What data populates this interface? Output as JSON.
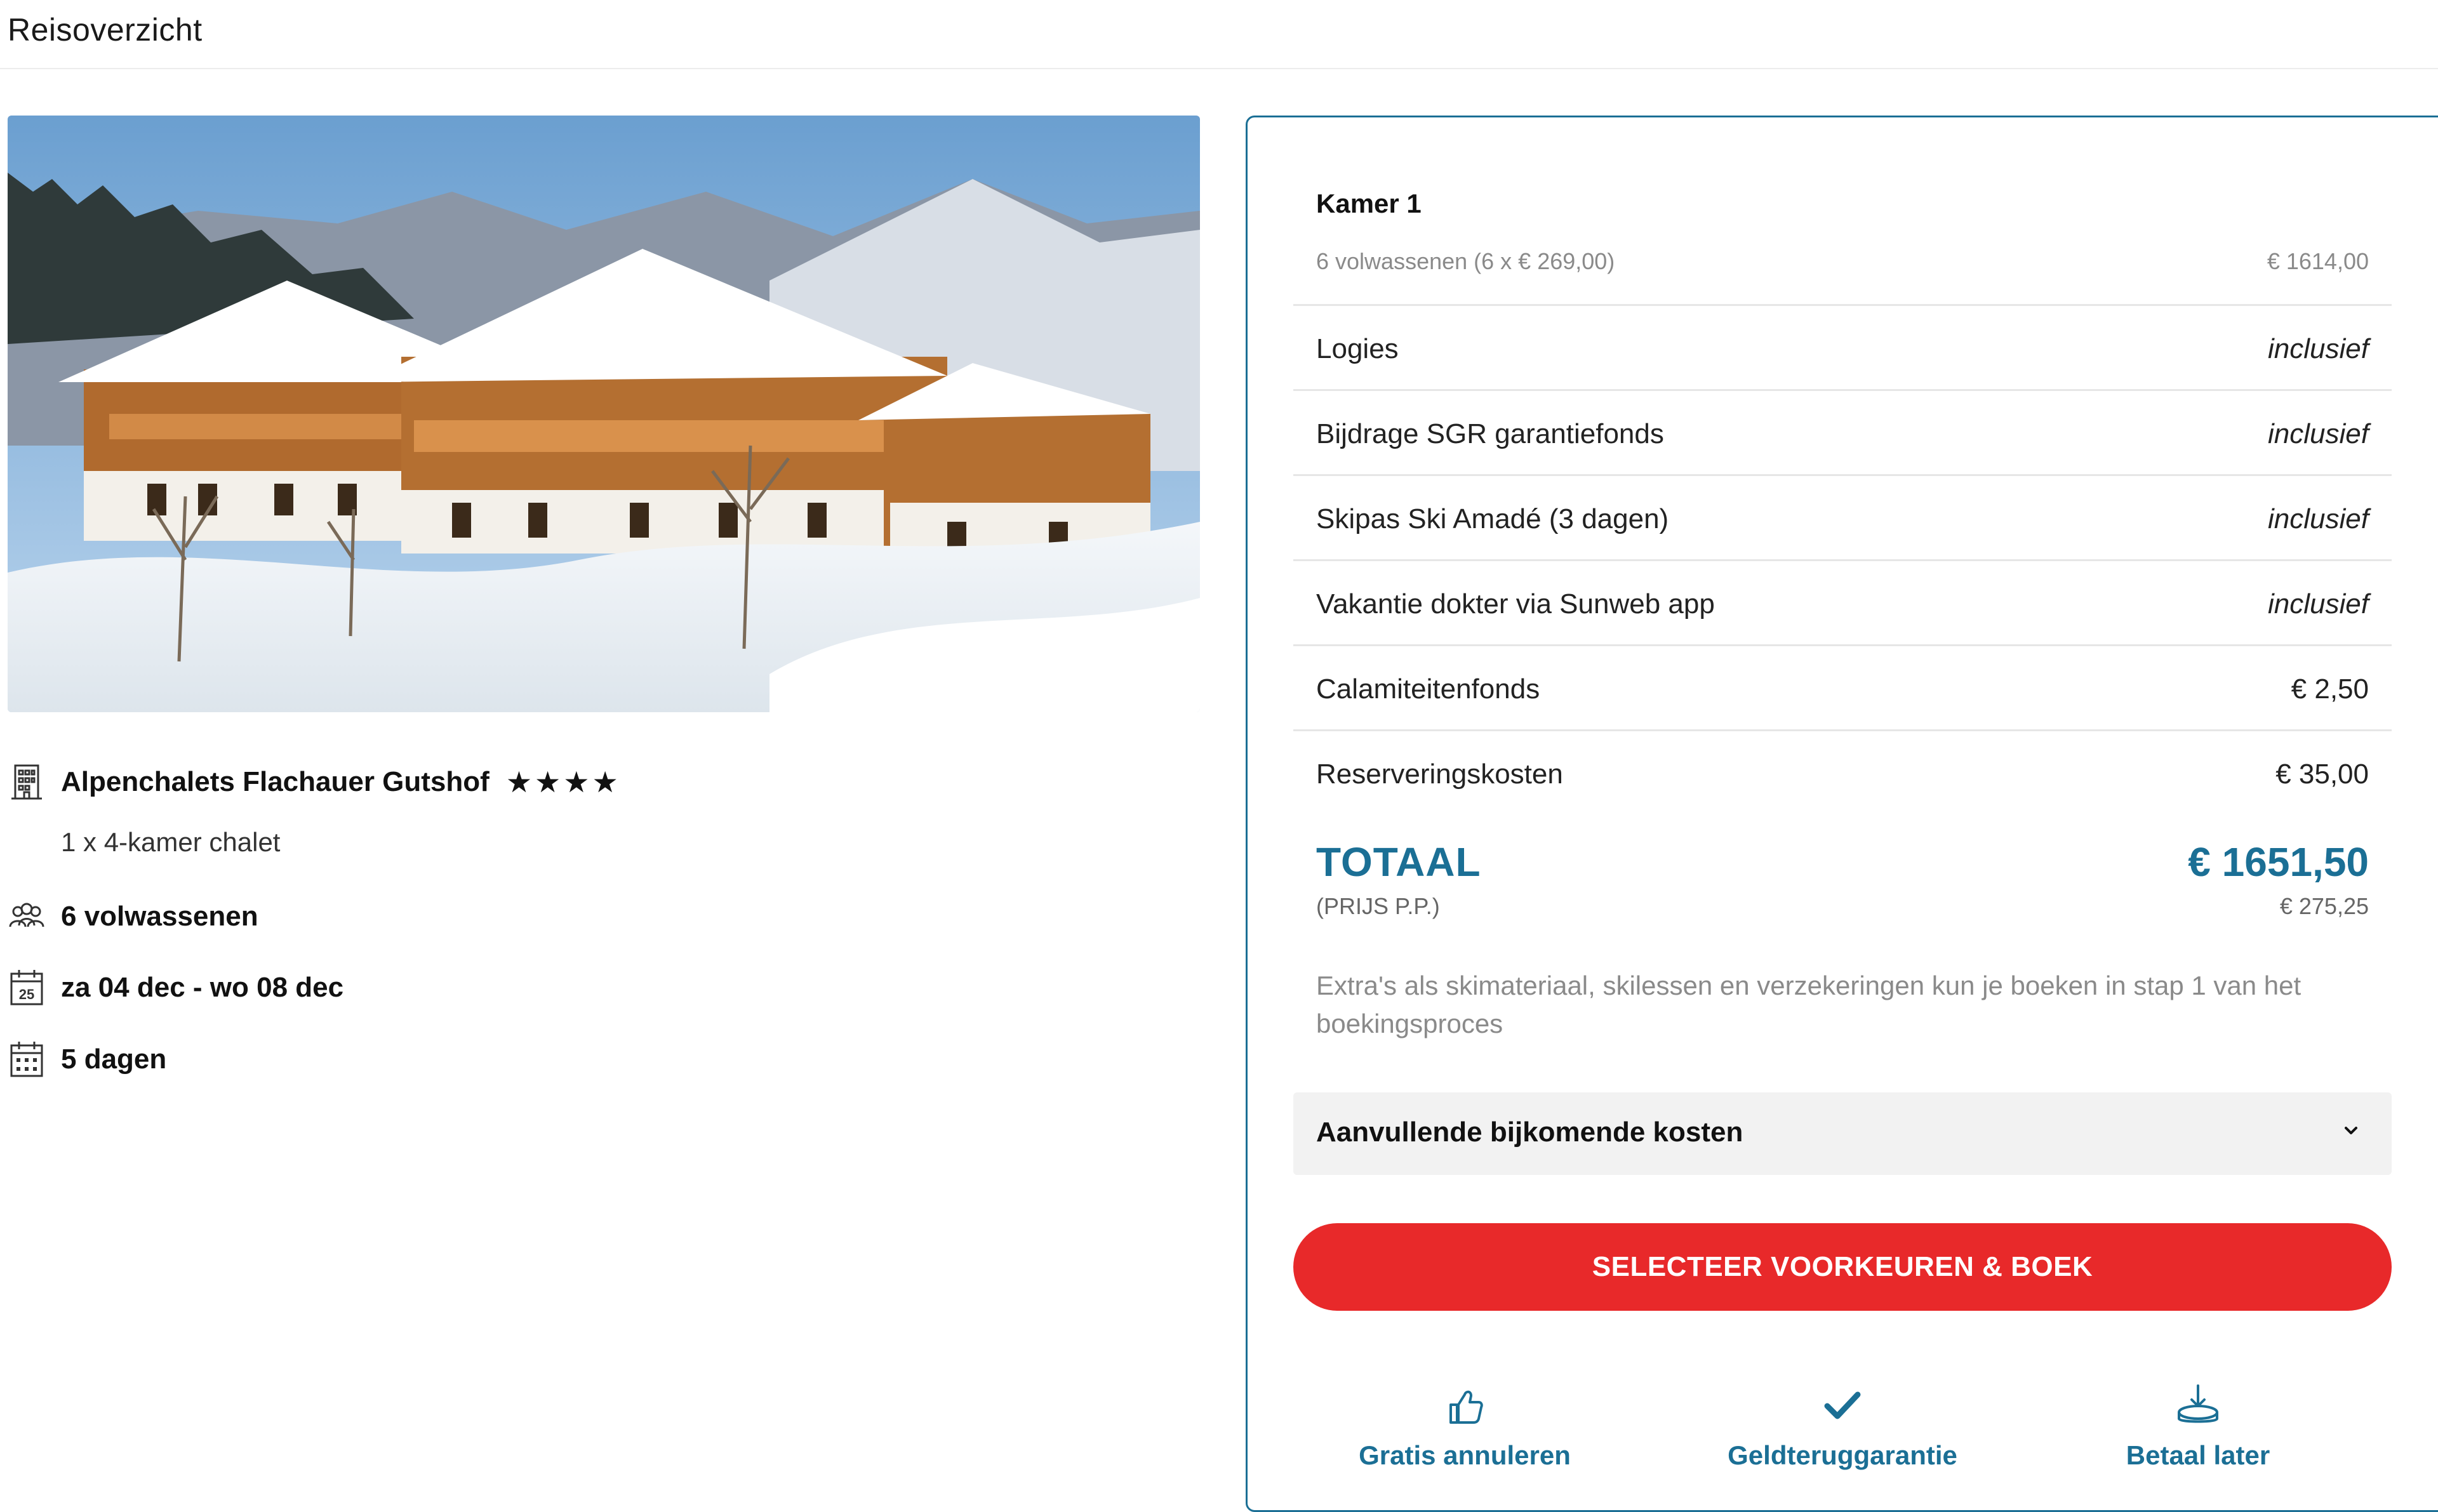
{
  "header": {
    "title": "Reisoverzicht"
  },
  "hotel": {
    "name": "Alpenchalets Flachauer Gutshof",
    "stars": "★★★★",
    "room_type": "1 x 4-kamer chalet",
    "image_alt": "Chalets in de sneeuw"
  },
  "trip": {
    "guests": "6 volwassenen",
    "dates": "za 04 dec - wo 08 dec",
    "calendar_day": "25",
    "duration": "5 dagen"
  },
  "summary": {
    "room_title": "Kamer 1",
    "room_detail": "6 volwassenen (6 x € 269,00)",
    "room_price": "€ 1614,00",
    "lines": [
      {
        "label": "Logies",
        "value": "inclusief"
      },
      {
        "label": "Bijdrage SGR garantiefonds",
        "value": "inclusief"
      },
      {
        "label": "Skipas Ski Amadé (3 dagen)",
        "value": "inclusief"
      },
      {
        "label": "Vakantie dokter via Sunweb app",
        "value": "inclusief"
      },
      {
        "label": "Calamiteitenfonds",
        "value": "€ 2,50"
      },
      {
        "label": "Reserveringskosten",
        "value": "€ 35,00"
      }
    ],
    "total_label": "TOTAAL",
    "total_value": "€ 1651,50",
    "pp_label": "(PRIJS P.P.)",
    "pp_value": "€ 275,25",
    "extras_note": "Extra's als skimateriaal, skilessen en verzekeringen kun je boeken in stap 1 van het boekingsproces",
    "accordion_label": "Aanvullende bijkomende kosten",
    "book_button": "SELECTEER VOORKEUREN & BOEK"
  },
  "usps": [
    {
      "label": "Gratis annuleren",
      "icon": "thumbs-up-icon"
    },
    {
      "label": "Geldteruggarantie",
      "icon": "checkmark-icon"
    },
    {
      "label": "Betaal later",
      "icon": "download-tray-icon"
    }
  ],
  "colors": {
    "accent_blue": "#1b6f95",
    "cta_red": "#e8292a",
    "muted_text": "#8a8a8a"
  }
}
